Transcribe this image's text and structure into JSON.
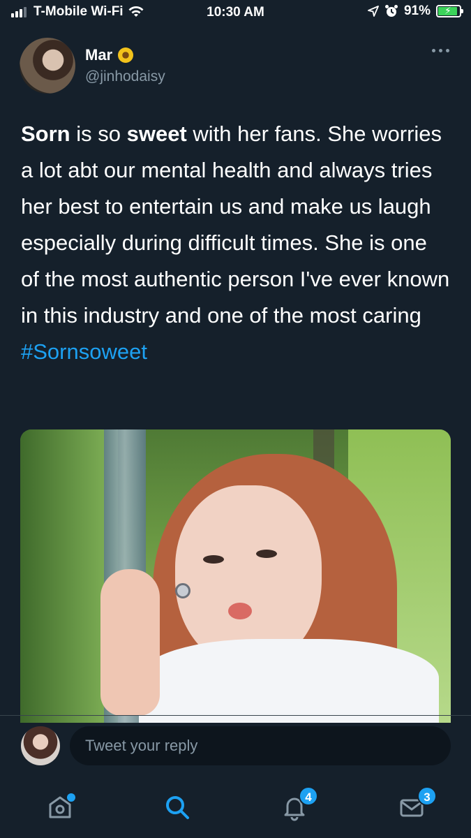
{
  "status_bar": {
    "carrier": "T-Mobile Wi-Fi",
    "time": "10:30 AM",
    "battery": "91%",
    "battery_level": 0.91,
    "icons": [
      "signal-icon",
      "wifi-icon",
      "location-icon",
      "alarm-icon",
      "battery-icon"
    ]
  },
  "tweet": {
    "author_name": "Mar",
    "author_handle": "@jinhodaisy",
    "text_parts": {
      "p1": "Sorn",
      "p2": " is so ",
      "p3": "sweet",
      "p4": " with her fans. She worries a lot abt our mental health and always tries her best to entertain us and make us laugh especially during difficult times. She is one of the most authentic person I've ever known in this industry and one of the most caring  ",
      "hashtag": "#Sornsoweet"
    }
  },
  "reply": {
    "placeholder": "Tweet your reply"
  },
  "nav": {
    "notifications_badge": "4",
    "messages_badge": "3"
  },
  "colors": {
    "background": "#15202b",
    "accent": "#1da1f2",
    "secondary_text": "#8899a6"
  }
}
